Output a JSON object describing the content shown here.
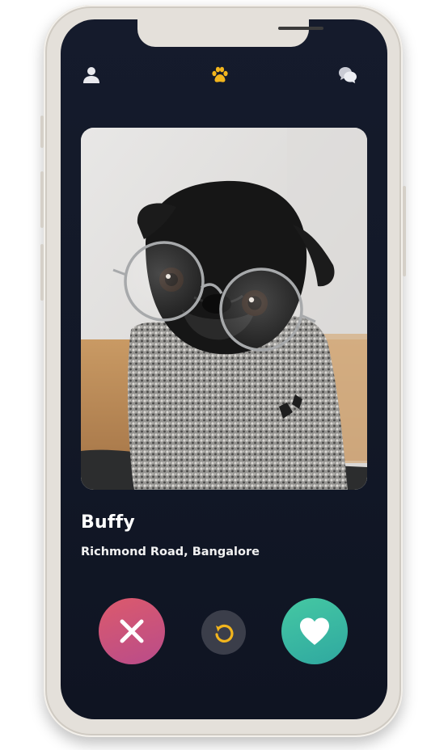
{
  "header": {
    "left_icon": "profile-icon",
    "center_icon": "paw-icon",
    "right_icon": "chat-icon",
    "accent_color": "#f2b51d"
  },
  "card": {
    "photo": "pug-with-glasses-and-sweater",
    "name": "Buffy",
    "location": "Richmond Road, Bangalore"
  },
  "actions": {
    "dislike": {
      "icon": "close-icon",
      "color": "#d45478"
    },
    "undo": {
      "icon": "undo-icon",
      "color": "#f2b51d"
    },
    "like": {
      "icon": "heart-icon",
      "color": "#3dbca2"
    }
  }
}
